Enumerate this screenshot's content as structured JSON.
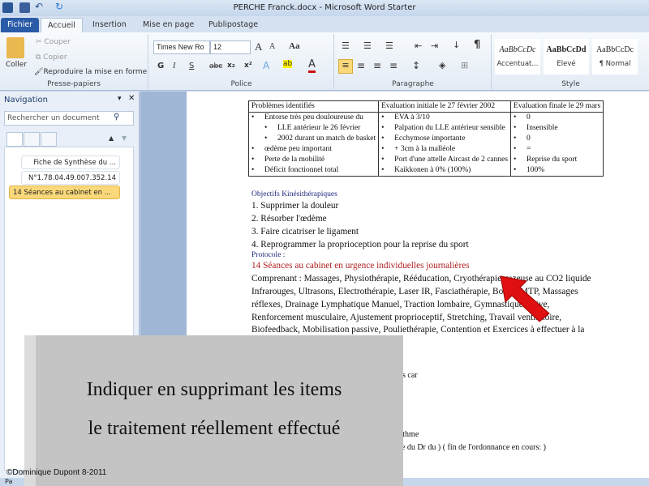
{
  "window": {
    "title": "PERCHE Franck.docx  -  Microsoft Word Starter"
  },
  "tabs": [
    "Fichier",
    "Accueil",
    "Insertion",
    "Mise en page",
    "Publipostage"
  ],
  "ribbon": {
    "clipboard": {
      "paste": "Coller",
      "cut": "Couper",
      "copy": "Copier",
      "format_painter": "Reproduire la mise en forme",
      "label": "Presse-papiers"
    },
    "font": {
      "name": "Times New Ro",
      "size": "12",
      "label": "Police",
      "bold": "G",
      "italic": "I",
      "underline": "S",
      "strike": "abc",
      "sub": "x₂",
      "sup": "x²"
    },
    "paragraph": {
      "label": "Paragraphe",
      "pilcrow": "¶"
    },
    "styles": {
      "label": "Style",
      "items": [
        {
          "preview": "AaBbCcDc",
          "name": "Accentuat..."
        },
        {
          "preview": "AaBbCcDd",
          "name": "Elevé"
        },
        {
          "preview": "AaBbCcDc",
          "name": "¶ Normal"
        }
      ]
    }
  },
  "navigation": {
    "title": "Navigation",
    "search_placeholder": "Rechercher un document",
    "items": [
      "Fiche de Synthèse du ...",
      "N°1.78.04.49.007.352.14",
      "14 Séances au cabinet en ..."
    ],
    "selected": 2
  },
  "document": {
    "table": {
      "headers": [
        "Problèmes identifiés",
        "Evaluation initiale le 27 février 2002",
        "Evaluation finale le 29 mars"
      ],
      "col1": [
        "Entorse très peu douloureuse du",
        "LLE  antérieur le 26 février",
        "2002  durant un match de basket",
        "œdème peu important",
        "Perte de la mobilité",
        "Déficit fonctionnel total"
      ],
      "col2": [
        "EVA  à 3/10",
        "Palpation du LLE  antérieur sensible",
        "Ecchymose importante",
        "+ 3cm à la malléole",
        "Port d'une attelle Aircast de 2 cannes",
        "Kaikkonen à 0% (100%)"
      ],
      "col3": [
        "0",
        "Insensible",
        "0",
        "=",
        "Reprise du sport",
        "100%"
      ]
    },
    "objectives_title": "Objectifs Kinésithérapiques",
    "objectives": [
      "1.   Supprimer  la douleur",
      "2.   Résorber l'œdème",
      "3.   Faire cicatriser  le ligament",
      "4.   Reprogrammer  la proprioception  pour la reprise du sport"
    ],
    "protocol_title": "Protocole :",
    "protocol_heading": "14 Séances au cabinet en urgence individuelles  journalières",
    "protocol_lines": [
      "Comprenant : Massages, Physiothérapie, Rééducation, Cryothérapie gazeuse au CO2 liquide",
      "Infrarouges, Ultrasons, Electrothérapie, Laser IR, Fasciathérapie, Boues, MTP, Massages",
      "réflexes, Drainage Lymphatique Manuel, Traction lombaire, Gymnastique active,",
      "Renforcement musculaire, Ajustement proprioceptif, Stretching, Travail ventilatoire,",
      "Biofeedback, Mobilisation passive, Pouliethérapie, Contention et Exercices à effectuer à la"
    ],
    "partial_lines": [
      "eints  car",
      "e  rythme",
      "ance  du Dr du ) ( fin  de l'ordonnance  en cours:  )"
    ]
  },
  "overlay": {
    "line1": "Indiquer en supprimant  les items",
    "line2": "le traitement  réellement  effectué",
    "copyright": "©Dominique Dupont  8-2011"
  },
  "statusbar": {
    "text": "Pa"
  },
  "colors": {
    "accent_file_tab": "#2a5ba6",
    "arrow": "#e01010",
    "heading_red": "#b02020",
    "heading_blue": "#1f2a80",
    "selected_nav": "#fbd97a"
  }
}
